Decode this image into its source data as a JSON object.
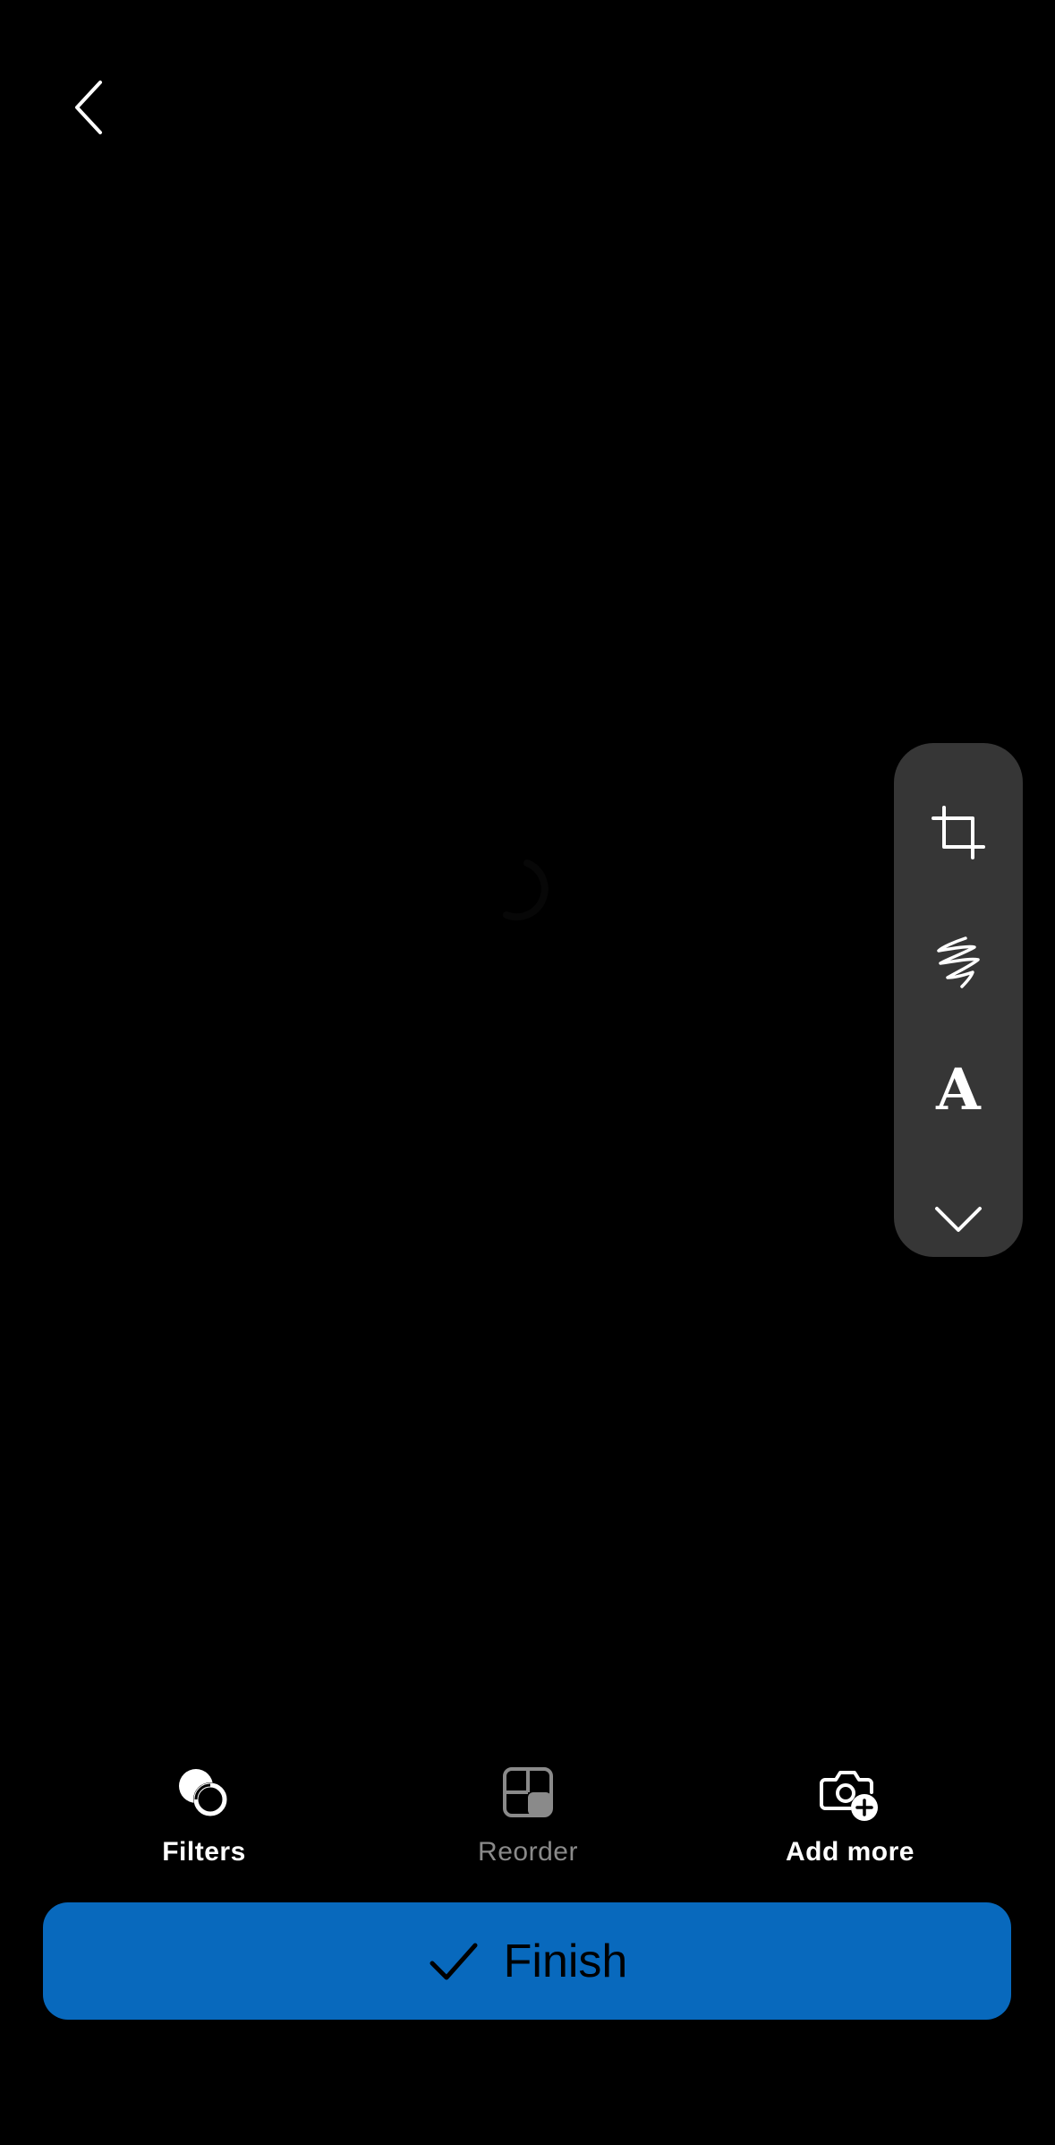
{
  "header": {
    "back_icon": "chevron-left-icon"
  },
  "preview": {
    "loading_icon": "loading-spinner-icon"
  },
  "tools": [
    {
      "name": "crop",
      "icon": "crop-icon"
    },
    {
      "name": "draw",
      "icon": "scribble-icon"
    },
    {
      "name": "text",
      "icon": "text-icon",
      "glyph": "A"
    },
    {
      "name": "more",
      "icon": "chevron-down-icon"
    }
  ],
  "bottom_actions": {
    "filters_label": "Filters",
    "reorder_label": "Reorder",
    "add_more_label": "Add more",
    "reorder_enabled": false
  },
  "finish": {
    "label": "Finish",
    "icon": "checkmark-icon"
  },
  "colors": {
    "background": "#000000",
    "tool_panel": "#363636",
    "accent": "#0869bd",
    "disabled": "#8a8a8a"
  }
}
